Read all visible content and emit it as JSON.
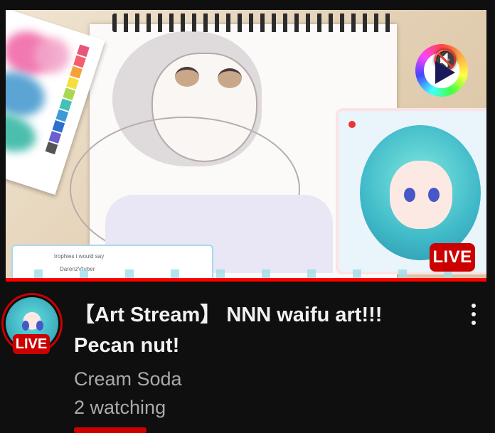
{
  "video": {
    "title": "【Art Stream】 NNN waifu art!!! Pecan nut!",
    "channel": "Cream Soda",
    "viewers": "2 watching",
    "thumbnail_live_badge": "LIVE",
    "avatar_live_badge": "LIVE",
    "mute_icon": "speaker-muted-icon",
    "more_icon": "vertical-dots-icon",
    "thumbnail_chat_lines": [
      "trophies i would say",
      "DarenzVtuber"
    ]
  },
  "colors": {
    "live_red": "#cc0000",
    "progress_red": "#ff0000",
    "background": "#0f0f0f",
    "title_text": "#f1f1f1",
    "secondary_text": "#aaaaaa"
  }
}
